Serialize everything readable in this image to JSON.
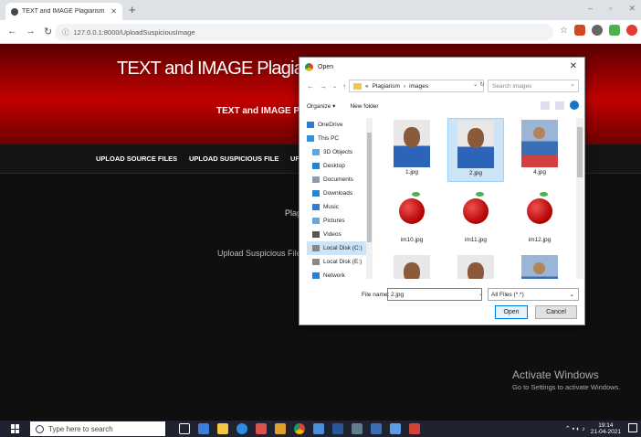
{
  "browser": {
    "tab_title": "TEXT and IMAGE Plagiarism Dete",
    "url": "127.0.0.1:8000/UploadSuspiciousImage",
    "window_controls": [
      "–",
      "▫",
      "✕"
    ]
  },
  "page": {
    "site_title": "TEXT and IMAGE Plagiarism Detec",
    "site_subtitle": "TEXT and IMAGE Plagi",
    "menu": [
      "UPLOAD SOURCE FILES",
      "UPLOAD SUSPICIOUS FILE",
      "UF"
    ],
    "content_heading": "Plagi",
    "upload_label": "Upload Suspicious File"
  },
  "watermark": {
    "line1": "Activate Windows",
    "line2": "Go to Settings to activate Windows."
  },
  "dialog": {
    "title": "Open",
    "close": "✕",
    "path": [
      "«",
      "Plagiarism",
      "›",
      "images"
    ],
    "search_placeholder": "Search images",
    "organize": "Organize ▾",
    "new_folder": "New folder",
    "sidebar": [
      {
        "label": "OneDrive",
        "icon": "cloud-icon",
        "color": "#2b7cd3"
      },
      {
        "label": "This PC",
        "icon": "pc-icon",
        "color": "#3a8fd8"
      },
      {
        "label": "3D Objects",
        "icon": "cube-icon",
        "color": "#59a8e8"
      },
      {
        "label": "Desktop",
        "icon": "desktop-icon",
        "color": "#2d7fcf"
      },
      {
        "label": "Documents",
        "icon": "document-icon",
        "color": "#8f9bb0"
      },
      {
        "label": "Downloads",
        "icon": "download-icon",
        "color": "#2d7fcf"
      },
      {
        "label": "Music",
        "icon": "music-icon",
        "color": "#2d7fcf"
      },
      {
        "label": "Pictures",
        "icon": "picture-icon",
        "color": "#6aa5d9"
      },
      {
        "label": "Videos",
        "icon": "video-icon",
        "color": "#555"
      },
      {
        "label": "Local Disk (C:)",
        "icon": "disk-icon",
        "color": "#888"
      },
      {
        "label": "Local Disk (E:)",
        "icon": "disk-icon",
        "color": "#888"
      },
      {
        "label": "Network",
        "icon": "network-icon",
        "color": "#2d7fcf"
      }
    ],
    "files": [
      {
        "name": "1.jpg",
        "kind": "person"
      },
      {
        "name": "2.jpg",
        "kind": "person",
        "selected": true
      },
      {
        "name": "4.jpg",
        "kind": "player"
      },
      {
        "name": "im10.jpg",
        "kind": "apple"
      },
      {
        "name": "im11.jpg",
        "kind": "apple"
      },
      {
        "name": "im12.jpg",
        "kind": "apple"
      },
      {
        "name": "",
        "kind": "person"
      },
      {
        "name": "",
        "kind": "person"
      },
      {
        "name": "",
        "kind": "player"
      }
    ],
    "filename_label": "File name:",
    "filename_value": "2.jpg",
    "filetype": "All Files (*.*)",
    "open_label": "Open",
    "cancel_label": "Cancel"
  },
  "taskbar": {
    "search_placeholder": "Type here to search",
    "time": "19:14",
    "date": "21-04-2021"
  },
  "colors": {
    "hero_red": "#c20000",
    "page_bg": "#0f0f0f",
    "selection": "#cce4f7",
    "taskbar": "#1f2330"
  }
}
